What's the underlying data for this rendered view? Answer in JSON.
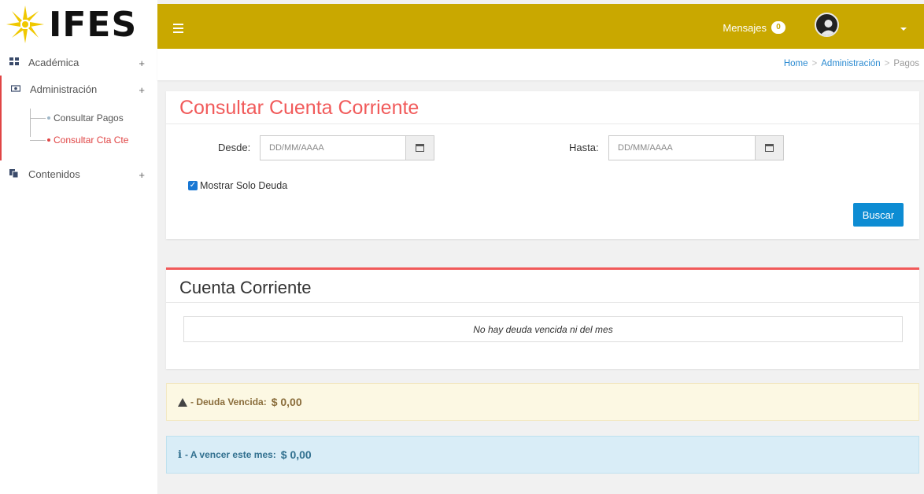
{
  "logo": {
    "text": "IFES"
  },
  "header": {
    "messages_label": "Mensajes",
    "messages_count": "0"
  },
  "sidebar": {
    "items": [
      {
        "label": "Académica",
        "icon": "grid-icon"
      },
      {
        "label": "Administración",
        "icon": "money-icon"
      },
      {
        "label": "Contenidos",
        "icon": "copy-icon"
      }
    ],
    "sub_items": [
      {
        "label": "Consultar Pagos",
        "active": false
      },
      {
        "label": "Consultar Cta Cte",
        "active": true
      }
    ]
  },
  "breadcrumb": {
    "home": "Home",
    "section": "Administración",
    "current": "Pagos"
  },
  "search_panel": {
    "title": "Consultar Cuenta Corriente",
    "desde_label": "Desde:",
    "desde_placeholder": "DD/MM/AAAA",
    "hasta_label": "Hasta:",
    "hasta_placeholder": "DD/MM/AAAA",
    "checkbox_label": "Mostrar Solo Deuda",
    "checkbox_checked": true,
    "search_button": "Buscar"
  },
  "results_panel": {
    "title": "Cuenta Corriente",
    "empty_message": "No hay deuda vencida ni del mes"
  },
  "alerts": {
    "overdue_label": "- Deuda Vencida:",
    "overdue_amount": "$ 0,00",
    "due_label": "- A vencer este mes:",
    "due_amount": "$ 0,00"
  },
  "colors": {
    "topbar": "#c9a800",
    "accent_red": "#f15a5a",
    "button_blue": "#0d8cd3"
  }
}
